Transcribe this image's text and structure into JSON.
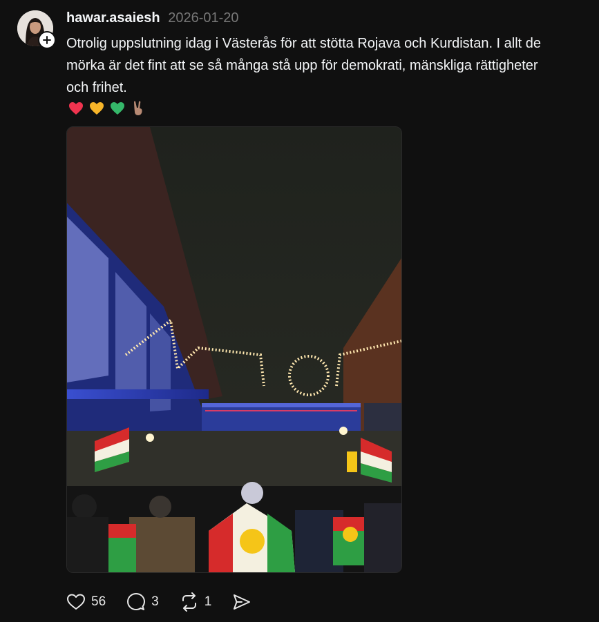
{
  "post": {
    "username": "hawar.asaiesh",
    "date": "2026-01-20",
    "caption_lines": [
      "Otrolig uppslutning idag i Västerås för att stötta Rojava och Kurdistan. I allt de",
      "mörka är det fint att se så många stå upp för demokrati, mänskliga rättigheter",
      "och frihet."
    ],
    "emojis": [
      "heart-red",
      "heart-yellow",
      "heart-green",
      "victory-hand"
    ],
    "photo_alt": "Crowd marching at night with Kurdish flags under festive street lights"
  },
  "actions": {
    "likes": "56",
    "replies": "3",
    "reposts": "1"
  },
  "icons": [
    "plus-icon",
    "heart-icon",
    "comment-icon",
    "repost-icon",
    "share-icon"
  ],
  "colors": {
    "background": "#101010",
    "text": "#f3f5f7",
    "muted": "#777777",
    "flag_red": "#d62b2b",
    "flag_yellow": "#f5c518",
    "flag_green": "#2e9e44"
  }
}
